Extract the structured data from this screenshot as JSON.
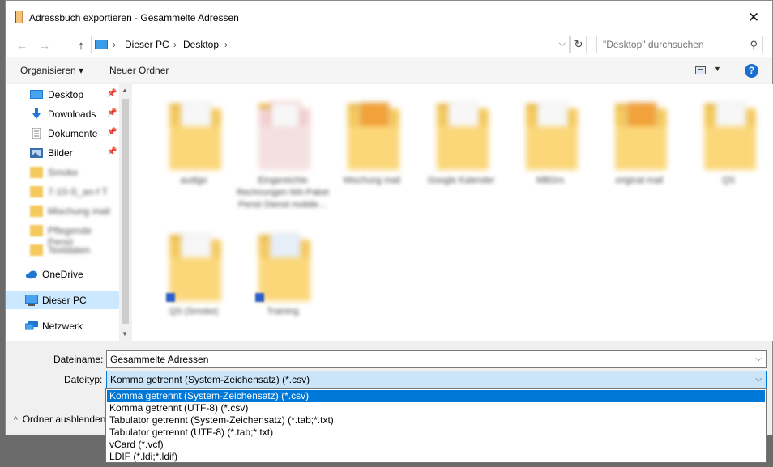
{
  "window": {
    "title": "Adressbuch exportieren - Gesammelte Adressen",
    "close_glyph": "✕"
  },
  "nav": {
    "back_glyph": "←",
    "forward_glyph": "→",
    "up_glyph": "↑",
    "breadcrumbs": [
      "Dieser PC",
      "Desktop"
    ],
    "crumb_sep": "›",
    "refresh_glyph": "↻",
    "search_placeholder": "\"Desktop\" durchsuchen",
    "search_glyph": "⚲"
  },
  "toolbar": {
    "organize_label": "Organisieren ▾",
    "new_folder_label": "Neuer Ordner",
    "help_label": "?"
  },
  "sidebar": {
    "quick_access": [
      {
        "label": "Desktop",
        "icon": "desktop-icon",
        "pinned": true
      },
      {
        "label": "Downloads",
        "icon": "download-icon",
        "pinned": true
      },
      {
        "label": "Dokumente",
        "icon": "document-icon",
        "pinned": true
      },
      {
        "label": "Bilder",
        "icon": "pictures-icon",
        "pinned": true
      }
    ],
    "pin_glyph": "📌",
    "blurred_folders": [
      "Smoke",
      "7-10-S_an-f T",
      "Mischung mail",
      "Pflegende Persö",
      "Textdaten"
    ],
    "onedrive_label": "OneDrive",
    "thispc_label": "Dieser PC",
    "network_label": "Netzwerk"
  },
  "files": [
    {
      "name": "audigo",
      "icon": "folder-icon"
    },
    {
      "name": "Eingereichte Rechnungen MA-Paket Persö Dienst mobile…",
      "icon": "pdf-folder-icon"
    },
    {
      "name": "Mischung mail",
      "icon": "folder-icon"
    },
    {
      "name": "Google Kalender",
      "icon": "folder-icon"
    },
    {
      "name": "MBGrs",
      "icon": "folder-icon"
    },
    {
      "name": "original mail",
      "icon": "folder-icon"
    },
    {
      "name": "QS",
      "icon": "folder-icon"
    },
    {
      "name": "QS (Smoke)",
      "icon": "folder-shortcut-icon"
    },
    {
      "name": "Training",
      "icon": "folder-shortcut-icon"
    }
  ],
  "form": {
    "filename_label": "Dateiname:",
    "filename_value": "Gesammelte Adressen",
    "filetype_label": "Dateityp:",
    "filetype_selected": "Komma getrennt (System-Zeichensatz) (*.csv)",
    "hide_folders_label": "Ordner ausblenden",
    "dropdown_arrow": "⌵"
  },
  "filetype_options": [
    "Komma getrennt (System-Zeichensatz) (*.csv)",
    "Komma getrennt (UTF-8) (*.csv)",
    "Tabulator getrennt (System-Zeichensatz) (*.tab;*.txt)",
    "Tabulator getrennt (UTF-8) (*.tab;*.txt)",
    "vCard (*.vcf)",
    "LDIF (*.ldi;*.ldif)"
  ],
  "colors": {
    "selection": "#0078d7",
    "nav_selected": "#cce8ff",
    "folder": "#f4c95d"
  }
}
